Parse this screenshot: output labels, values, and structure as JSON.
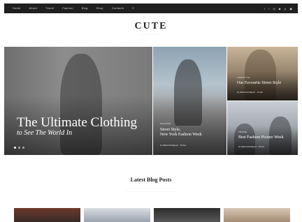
{
  "nav": {
    "items": [
      "Home",
      "About",
      "Travel",
      "Fashion",
      "Blog",
      "Shop",
      "Contacts"
    ],
    "search_icon": "search-icon"
  },
  "social": {
    "icons": [
      "facebook-icon",
      "twitter-icon",
      "instagram-icon",
      "youtube-icon",
      "pinterest-icon",
      "rss-icon"
    ],
    "glyphs": [
      "f",
      "t",
      "◎",
      "▶",
      "p",
      "▣"
    ]
  },
  "brand": {
    "logo": "CUTE"
  },
  "hero": {
    "main": {
      "title": "The Ultimate Clothing",
      "subtitle": "to See The World In"
    },
    "mid": {
      "category": "Fashion",
      "title_line1": "Street Style,",
      "title_line2": "New York Fashion Week",
      "meta": "by Maria Rodriguez · 15 Apr"
    },
    "top_right": {
      "category": "Lifestyle",
      "title": "Our Favourite Street Style",
      "meta": "by Maria Rodriguez · 12 Apr"
    },
    "bottom_right": {
      "category": "Travel",
      "title": "Best Fashion Picture Week",
      "meta": "by Maria Rodriguez · 10 Apr"
    }
  },
  "latest": {
    "title": "Latest Blog Posts"
  },
  "colors": {
    "topbar": "#1f1f1f",
    "accent": "#ffffff"
  }
}
